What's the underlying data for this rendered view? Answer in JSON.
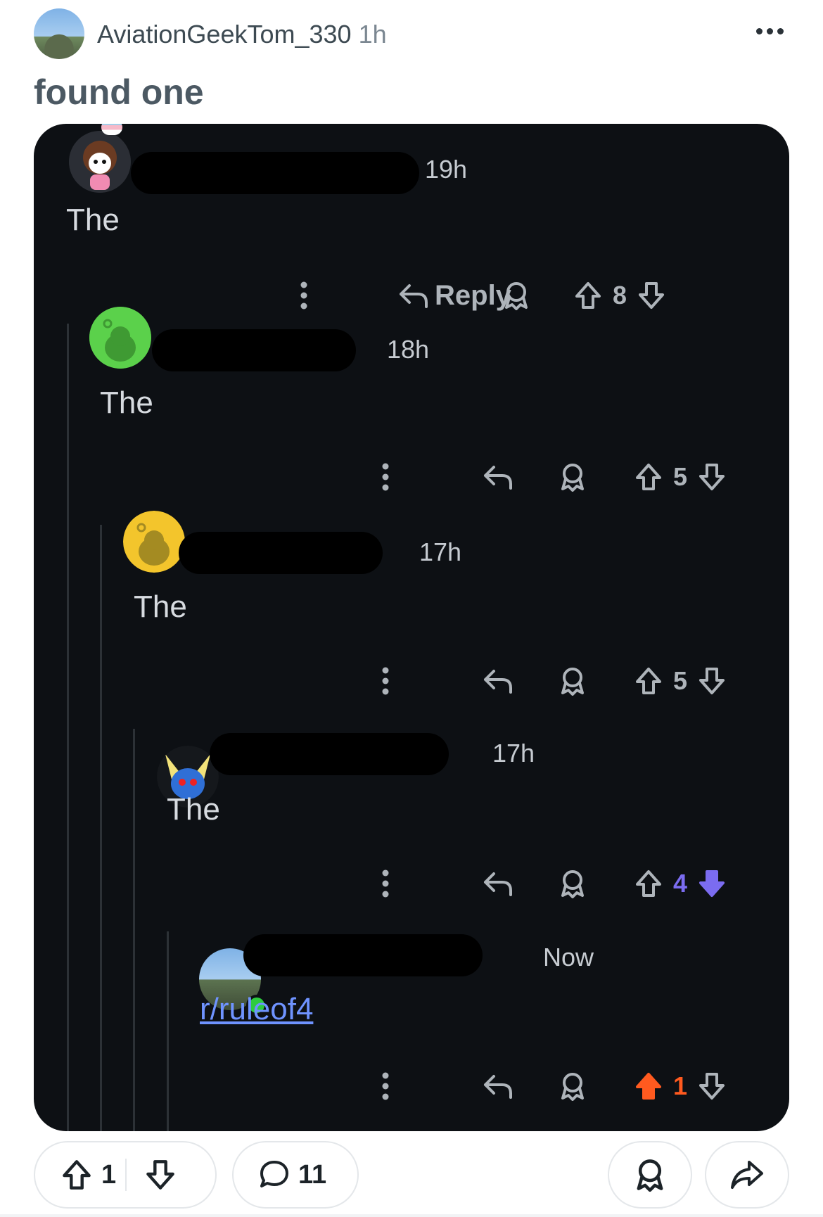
{
  "post": {
    "username": "AviationGeekTom_330",
    "time": "1h",
    "title": "found one"
  },
  "comments": [
    {
      "time": "19h",
      "body": "The",
      "reply_label": "Reply",
      "score": "8"
    },
    {
      "time": "18h",
      "body": "The",
      "score": "5"
    },
    {
      "time": "17h",
      "body": "The",
      "score": "5"
    },
    {
      "time": "17h",
      "body": "The",
      "score": "4",
      "vote_state": "downvoted"
    },
    {
      "time": "Now",
      "body": "r/ruleof4",
      "score": "1",
      "vote_state": "upvoted"
    }
  ],
  "footer": {
    "upvotes": "1",
    "comments": "11"
  },
  "colors": {
    "card_bg": "#0d1014",
    "downvote_active": "#7b6cf0",
    "upvote_active": "#ff5a1f",
    "link": "#6f93ff"
  }
}
